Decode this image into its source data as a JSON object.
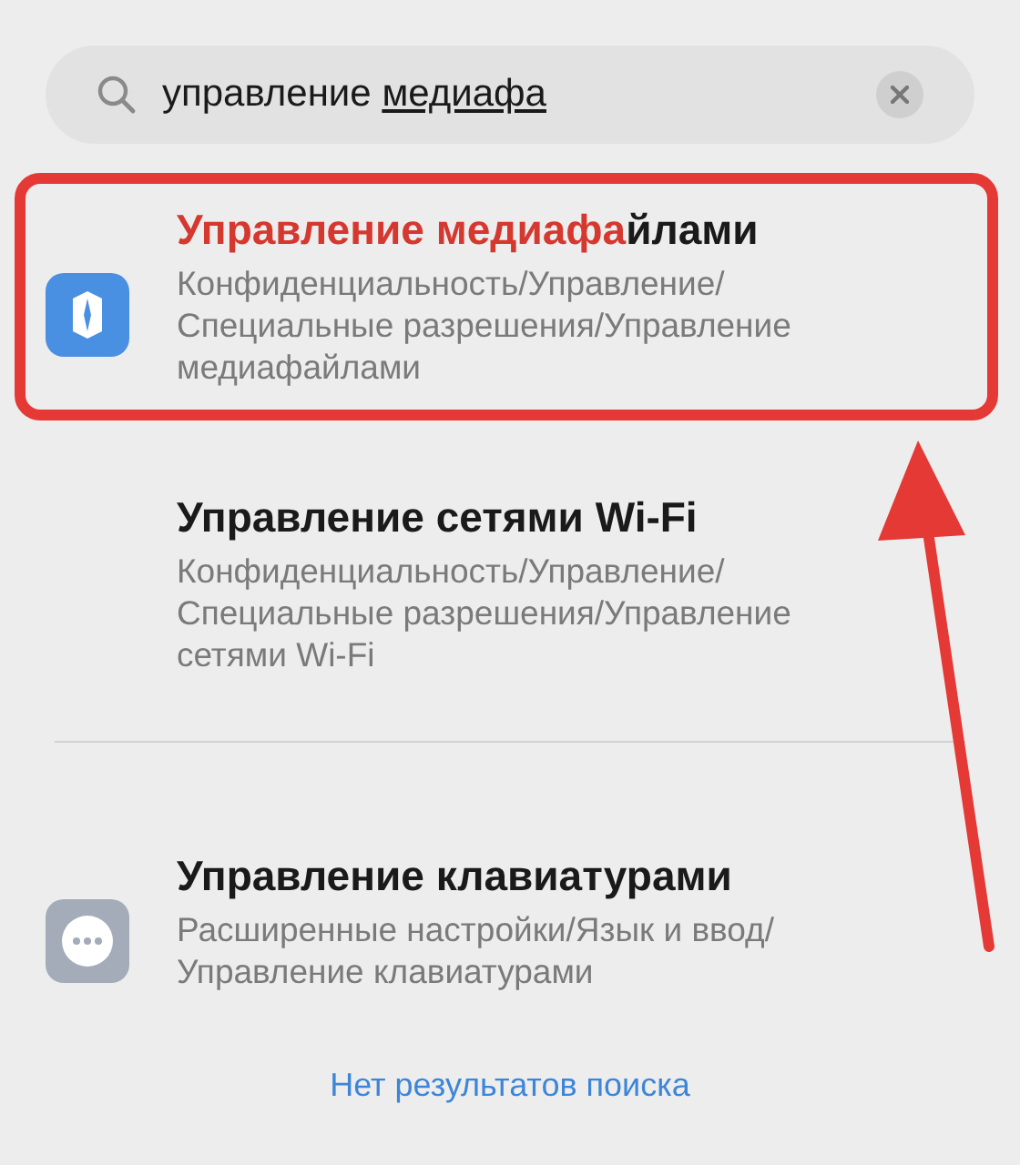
{
  "search": {
    "query_committed": "управление ",
    "query_composing": "медиафа"
  },
  "results": [
    {
      "kind": "media",
      "title_match": "Управление медиафа",
      "title_rest": "йлами",
      "path": "Конфиденциальность/Управление/ Специальные разрешения/Управление медиафайлами",
      "highlighted": true,
      "divider_after": false
    },
    {
      "kind": "network",
      "title_rest": "Управление сетями Wi-Fi",
      "path": "Конфиденциальность/Управление/ Специальные разрешения/Управление сетями Wi-Fi",
      "highlighted": false,
      "divider_after": true
    },
    {
      "kind": "input",
      "title_rest": "Управление клавиатурами",
      "path": "Расширенные настройки/Язык и ввод/ Управление клавиатурами",
      "highlighted": false,
      "divider_after": false
    }
  ],
  "footer": "Нет результатов поиска"
}
